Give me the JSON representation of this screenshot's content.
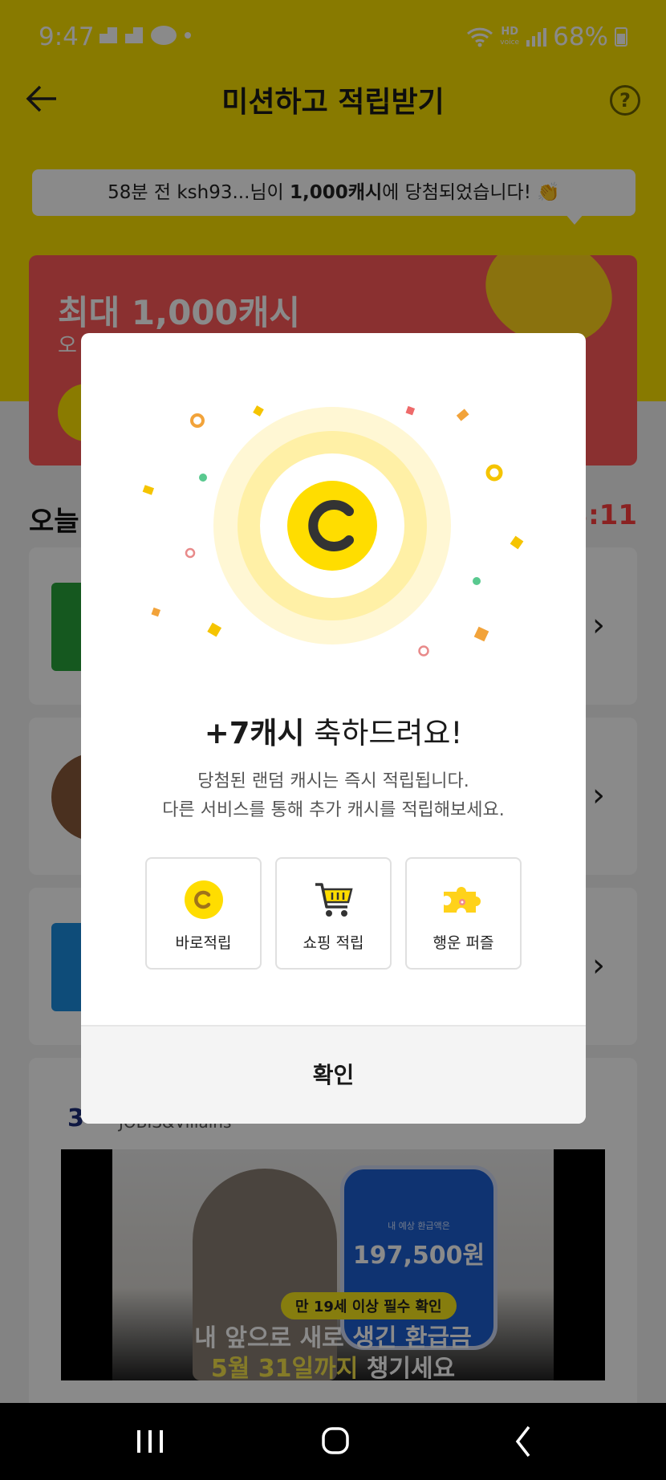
{
  "status_bar": {
    "time": "9:47",
    "hd_top": "HD",
    "hd_bottom": "voice",
    "battery": "68%"
  },
  "header": {
    "title": "미션하고 적립받기"
  },
  "toast": {
    "prefix": "58분 전 ksh93...님이 ",
    "bold": "1,000캐시",
    "suffix": "에 당첨되었습니다! 👏"
  },
  "promo": {
    "title": "최대 1,000캐시",
    "subtitle": "오"
  },
  "section": {
    "title": "오늘",
    "timer": "3:11"
  },
  "cards": [
    {
      "thumb_color": "#27a33a"
    },
    {
      "thumb_color": "#8a5a3a"
    },
    {
      "thumb_color": "#1b8de0"
    }
  ],
  "ad": {
    "brand_mark": "3",
    "brand_name": "JOBIS&Villains",
    "phone_label": "내 예상 환급액은",
    "phone_amount": "197,500원",
    "badge": "만 19세 이상 필수 확인",
    "line1": "내 앞으로 새로 생긴 환급금",
    "line2_highlight": "5월 31일까지",
    "line2_rest": " 챙기세요"
  },
  "modal": {
    "title_bold": "+7캐시",
    "title_rest": " 축하드려요!",
    "desc_line1": "당첨된 랜덤 캐시는 즉시 적립됩니다.",
    "desc_line2": "다른 서비스를 통해 추가 캐시를 적립해보세요.",
    "options": [
      {
        "label": "바로적립",
        "icon": "coin-icon"
      },
      {
        "label": "쇼핑 적립",
        "icon": "cart-icon"
      },
      {
        "label": "행운 퍼즐",
        "icon": "puzzle-icon"
      }
    ],
    "confirm_label": "확인"
  },
  "colors": {
    "brand_yellow": "#fce100",
    "promo_red": "#ff5a5a",
    "coin_yellow": "#ffdd00",
    "timer_red": "#ff3d3d"
  }
}
